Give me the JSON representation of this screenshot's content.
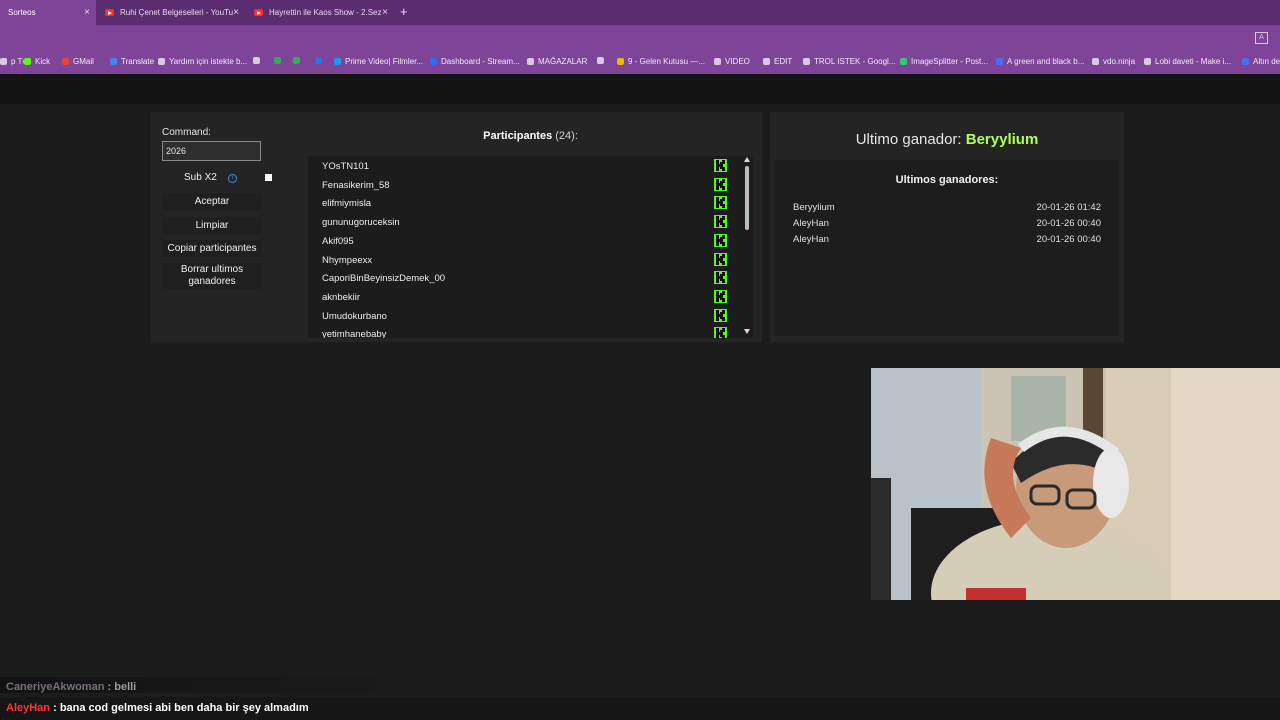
{
  "browser": {
    "tabs": [
      {
        "label": "Sorteos",
        "active": true
      },
      {
        "label": "Ruhi Çenet Belgeselleri - YouTu",
        "active": false
      },
      {
        "label": "Hayrettin ile Kaos Show - 2.Sez",
        "active": false
      }
    ],
    "new_tab": "+",
    "tab_close": "×",
    "bookmarks": [
      {
        "label": "p Tv",
        "icon": "tv-icon"
      },
      {
        "label": "Kick",
        "icon": "kick-icon",
        "color": "#53fc18"
      },
      {
        "label": "GMail",
        "icon": "gmail-icon",
        "color": "#ea4335"
      },
      {
        "label": "Translate",
        "icon": "translate-icon",
        "color": "#4285f4"
      },
      {
        "label": "Yardım için istekte b...",
        "icon": "globe-icon"
      },
      {
        "label": "",
        "icon": "x-icon"
      },
      {
        "label": "",
        "icon": "drive-icon",
        "color": "#34a853"
      },
      {
        "label": "",
        "icon": "feedly-icon",
        "color": "#2bb24c"
      },
      {
        "label": "",
        "icon": "facebook-icon",
        "color": "#1877f2"
      },
      {
        "label": "Prime Video| Filmler...",
        "icon": "prime-icon",
        "color": "#1a98ff"
      },
      {
        "label": "Dashboard - Stream...",
        "icon": "streamelements-icon",
        "color": "#2c6cf6"
      },
      {
        "label": "MAĞAZALAR",
        "icon": "folder-icon"
      },
      {
        "label": "",
        "icon": "globe-icon"
      },
      {
        "label": "9 - Gelen Kutusu —...",
        "icon": "mail-icon",
        "color": "#f4b400"
      },
      {
        "label": "VIDEO",
        "icon": "folder-icon"
      },
      {
        "label": "EDIT",
        "icon": "folder-icon"
      },
      {
        "label": "TROL ISTEK - Googl...",
        "icon": "sheets-icon"
      },
      {
        "label": "ImageSplitter - Post...",
        "icon": "image-icon",
        "color": "#2ecc71"
      },
      {
        "label": "A green and black b...",
        "icon": "doc-icon",
        "color": "#4a6cf7"
      },
      {
        "label": "vdo.ninja",
        "icon": "vdo-icon"
      },
      {
        "label": "Lobi daveti - Make i...",
        "icon": "lobby-icon"
      },
      {
        "label": "Altın de",
        "icon": "doc-icon",
        "color": "#4a6cf7"
      }
    ]
  },
  "controls": {
    "command_label": "Command:",
    "command_value": "2026",
    "sub_label": "Sub X2",
    "info_glyph": "i",
    "accept": "Aceptar",
    "clear": "Limpiar",
    "copy": "Copiar participantes",
    "erase": "Borrar ultimos ganadores"
  },
  "participants": {
    "title": "Participantes",
    "count": "(24):",
    "items": [
      "YOsTN101",
      "Fenasikerim_58",
      "elifmiymisla",
      "gununugoruceksin",
      "Akif095",
      "Nhympeexx",
      "CaporiBinBeyinsizDemek_00",
      "aknbekiir",
      "Umudokurbano",
      "yetimhanebaby"
    ]
  },
  "winners": {
    "last_label": "Ultimo ganador:",
    "last_name": "Beryylium",
    "list_title": "Ultimos ganadores:",
    "items": [
      {
        "name": "Beryylium",
        "date": "20-01-26 01:42"
      },
      {
        "name": "AleyHan",
        "date": "20-01-26 00:40"
      },
      {
        "name": "AleyHan",
        "date": "20-01-26 00:40"
      }
    ]
  },
  "chat": [
    {
      "user": "CaneriyeAkwoman",
      "sep": ":",
      "message": "belli",
      "color": "#7a6d7f"
    },
    {
      "user": "AleyHan",
      "sep": ":",
      "message": "bana cod gelmesi abi ben daha bir şey almadım",
      "color": "#ff3434"
    }
  ],
  "colors": {
    "accent_green": "#adff5c",
    "kick_green": "#53fc18",
    "tab_purple": "#7e4498"
  }
}
